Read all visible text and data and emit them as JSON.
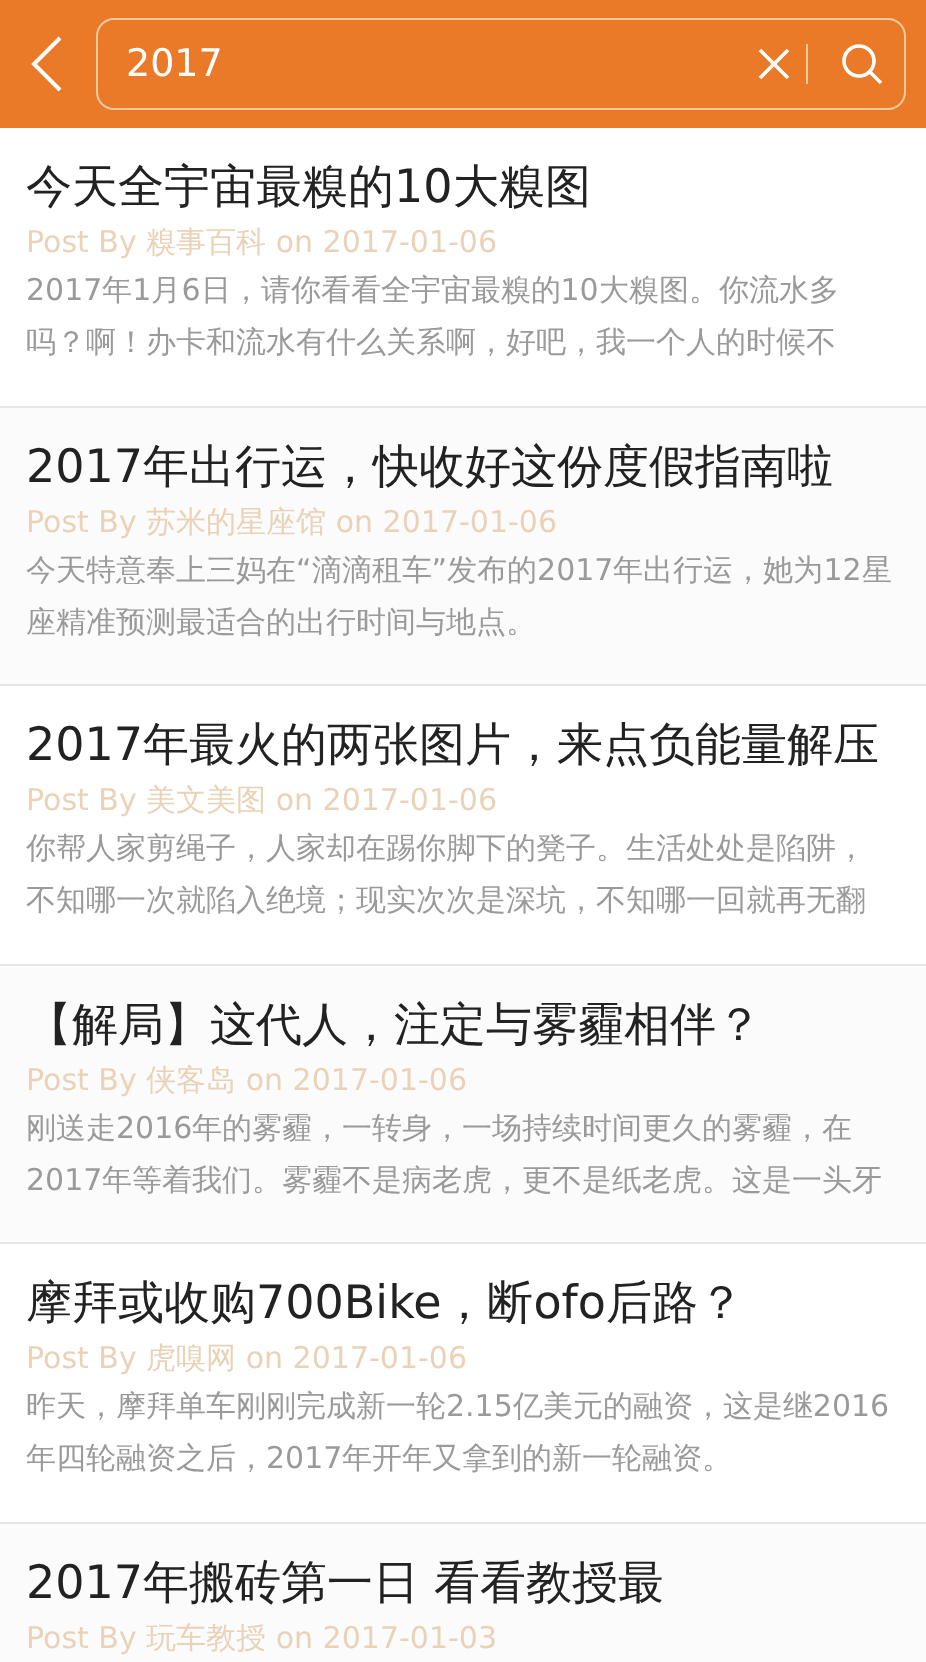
{
  "search": {
    "value": "2017"
  },
  "posts": [
    {
      "title": "今天全宇宙最糗的10大糗图",
      "meta": "Post By 糗事百科 on 2017-01-06",
      "lines": [
        "2017年1月6日，请你看看全宇宙最糗的10大糗图。你流水多",
        "吗？啊！办卡和流水有什么关系啊，好吧，我一个人的时候不"
      ]
    },
    {
      "title": "2017年出行运，快收好这份度假指南啦",
      "meta": "Post By 苏米的星座馆 on 2017-01-06",
      "lines": [
        "今天特意奉上三妈在“滴滴租车”发布的2017年出行运，她为12星",
        "座精准预测最适合的出行时间与地点。"
      ]
    },
    {
      "title": "2017年最火的两张图片，来点负能量解压",
      "meta": "Post By 美文美图 on 2017-01-06",
      "lines": [
        "你帮人家剪绳子，人家却在踢你脚下的凳子。生活处处是陷阱，",
        "不知哪一次就陷入绝境；现实次次是深坑，不知哪一回就再无翻"
      ]
    },
    {
      "title": "【解局】这代人，注定与雾霾相伴？",
      "meta": "Post By 侠客岛 on 2017-01-06",
      "lines": [
        "刚送走2016年的雾霾，一转身，一场持续时间更久的雾霾，在",
        "2017年等着我们。雾霾不是病老虎，更不是纸老虎。这是一头牙"
      ]
    },
    {
      "title": "摩拜或收购700Bike，断ofo后路？",
      "meta": "Post By 虎嗅网 on 2017-01-06",
      "lines": [
        "昨天，摩拜单车刚刚完成新一轮2.15亿美元的融资，这是继2016",
        "年四轮融资之后，2017年开年又拿到的新一轮融资。"
      ]
    },
    {
      "title": "2017年搬砖第一日 看看教授最",
      "meta": "Post By 玩车教授 on 2017-01-03"
    }
  ]
}
